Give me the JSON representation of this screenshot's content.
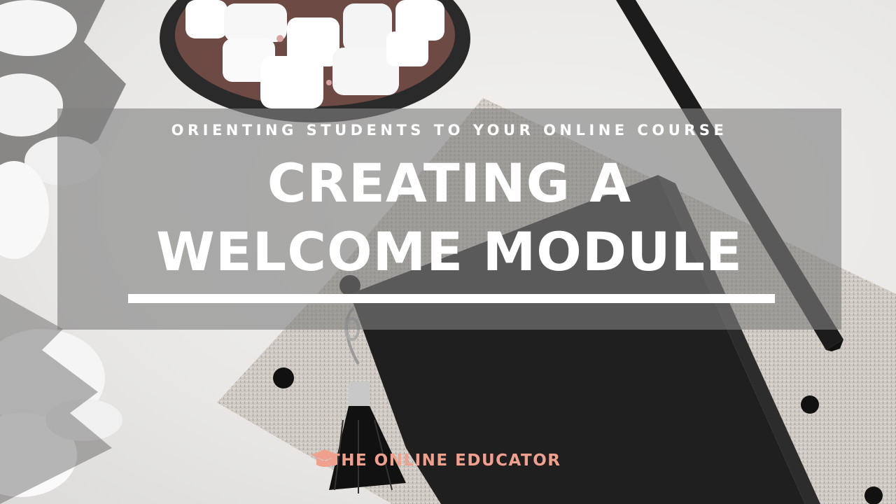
{
  "header": {
    "subtitle": "ORIENTING STUDENTS TO YOUR ONLINE COURSE",
    "title_line1": "CREATING A",
    "title_line2": "WELCOME MODULE"
  },
  "footer": {
    "brand_name": "THE ONLINE EDUCATOR",
    "brand_icon": "graduation-cap-icon"
  },
  "colors": {
    "brand": "#f0a08e",
    "banner_overlay": "#808080",
    "title_text": "#ffffff"
  },
  "background": {
    "scene": [
      "hot-cocoa-mug",
      "marshmallows",
      "snowy-pine-branches",
      "black-pencil",
      "black-notebook",
      "tweed-planner",
      "tassel-keychain"
    ]
  }
}
